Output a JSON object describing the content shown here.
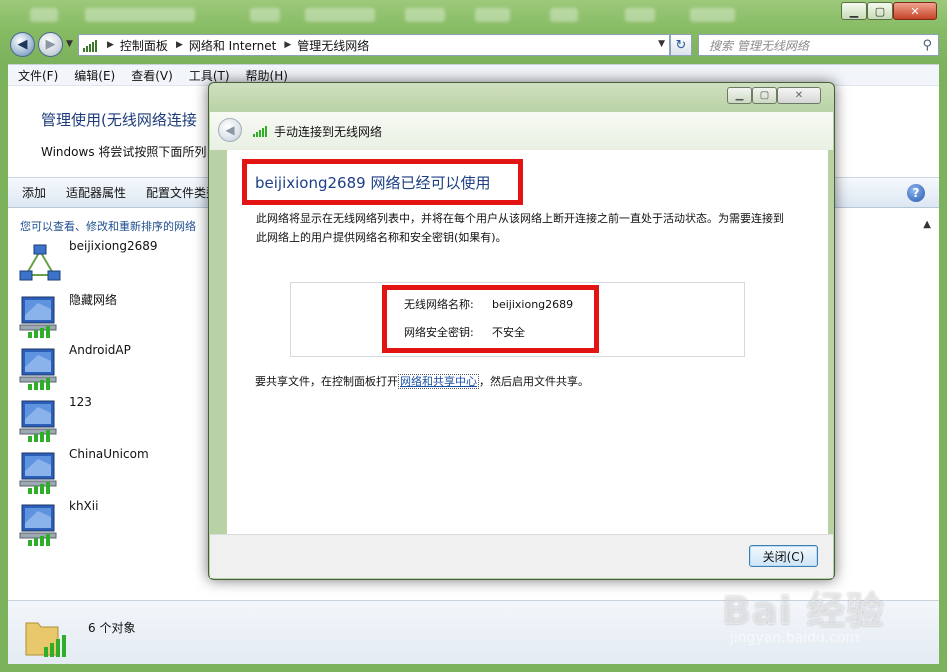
{
  "explorer": {
    "breadcrumb": [
      "控制面板",
      "网络和 Internet",
      "管理无线网络"
    ],
    "search_placeholder": "搜索 管理无线网络",
    "menu": [
      "文件(F)",
      "编辑(E)",
      "查看(V)",
      "工具(T)",
      "帮助(H)"
    ],
    "page_title": "管理使用(无线网络连接",
    "page_desc": "Windows 将尝试按照下面所列",
    "commands": [
      "添加",
      "适配器属性",
      "配置文件类型"
    ],
    "list_hint": "您可以查看、修改和重新排序的网络",
    "networks": [
      "beijixiong2689",
      "隐藏网络",
      "AndroidAP",
      "123",
      "ChinaUnicom",
      "khXii"
    ],
    "status_text": "6 个对象"
  },
  "dialog": {
    "title": "手动连接到无线网络",
    "heading": "beijixiong2689 网络已经可以使用",
    "description": "此网络将显示在无线网络列表中，并将在每个用户从该网络上断开连接之前一直处于活动状态。为需要连接到此网络上的用户提供网络名称和安全密钥(如果有)。",
    "ssid_label": "无线网络名称:",
    "ssid_value": "beijixiong2689",
    "security_label": "网络安全密钥:",
    "security_value": "不安全",
    "share_prefix": "要共享文件，在控制面板打开",
    "share_link": "网络和共享中心",
    "share_suffix": "，然后启用文件共享。",
    "close_button": "关闭(C)"
  },
  "watermark": {
    "logo": "Bai 经验",
    "url": "jingyan.baidu.com"
  },
  "colors": {
    "highlight_red": "#e31414",
    "title_blue": "#1d3f86",
    "link_blue": "#1b4fa5",
    "frame_green": "#b9d2a5"
  }
}
